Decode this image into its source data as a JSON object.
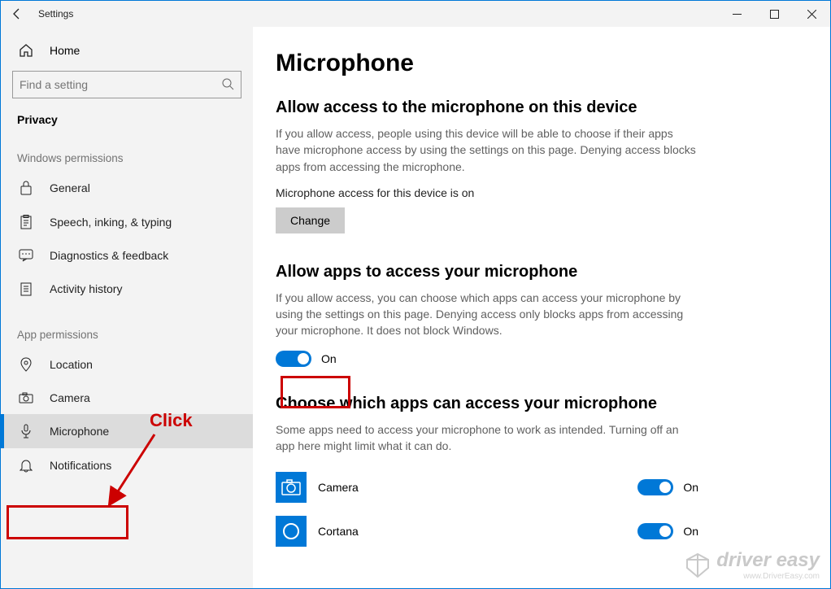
{
  "window": {
    "title": "Settings"
  },
  "sidebar": {
    "home": "Home",
    "search_placeholder": "Find a setting",
    "category": "Privacy",
    "group_win": "Windows permissions",
    "group_app": "App permissions",
    "win_items": [
      {
        "label": "General"
      },
      {
        "label": "Speech, inking, & typing"
      },
      {
        "label": "Diagnostics & feedback"
      },
      {
        "label": "Activity history"
      }
    ],
    "app_items": [
      {
        "label": "Location"
      },
      {
        "label": "Camera"
      },
      {
        "label": "Microphone",
        "selected": true
      },
      {
        "label": "Notifications"
      }
    ]
  },
  "main": {
    "title": "Microphone",
    "s1_heading": "Allow access to the microphone on this device",
    "s1_desc": "If you allow access, people using this device will be able to choose if their apps have microphone access by using the settings on this page. Denying access blocks apps from accessing the microphone.",
    "s1_status": "Microphone access for this device is on",
    "change_btn": "Change",
    "s2_heading": "Allow apps to access your microphone",
    "s2_desc": "If you allow access, you can choose which apps can access your microphone by using the settings on this page. Denying access only blocks apps from accessing your microphone. It does not block Windows.",
    "toggle_on": "On",
    "s3_heading": "Choose which apps can access your microphone",
    "s3_desc": "Some apps need to access your microphone to work as intended. Turning off an app here might limit what it can do.",
    "apps": [
      {
        "name": "Camera",
        "state": "On"
      },
      {
        "name": "Cortana",
        "state": "On"
      }
    ]
  },
  "annotation": {
    "click": "Click"
  },
  "watermark": {
    "brand": "driver easy",
    "url": "www.DriverEasy.com"
  }
}
